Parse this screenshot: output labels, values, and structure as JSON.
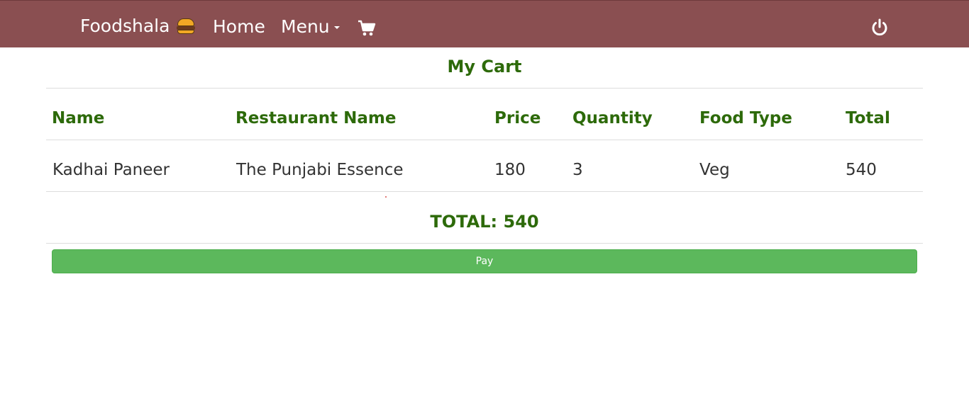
{
  "navbar": {
    "brand": "Foodshala",
    "brand_icon": "burger-icon",
    "home_label": "Home",
    "menu_label": "Menu",
    "cart_icon": "shopping-cart-icon",
    "logout_icon": "power-icon",
    "background_color": "#8a4f51"
  },
  "page": {
    "title": "My Cart"
  },
  "table": {
    "headers": [
      "Name",
      "Restaurant Name",
      "Price",
      "Quantity",
      "Food Type",
      "Total"
    ],
    "rows": [
      [
        "Kadhai Paneer",
        "The Punjabi Essence",
        "180",
        "3",
        "Veg",
        "540"
      ]
    ]
  },
  "summary": {
    "total_text": "TOTAL: 540"
  },
  "actions": {
    "pay_label": "Pay",
    "pay_color": "#5cb85c"
  },
  "colors": {
    "heading": "#2d6a0a",
    "body_text": "#333333"
  }
}
